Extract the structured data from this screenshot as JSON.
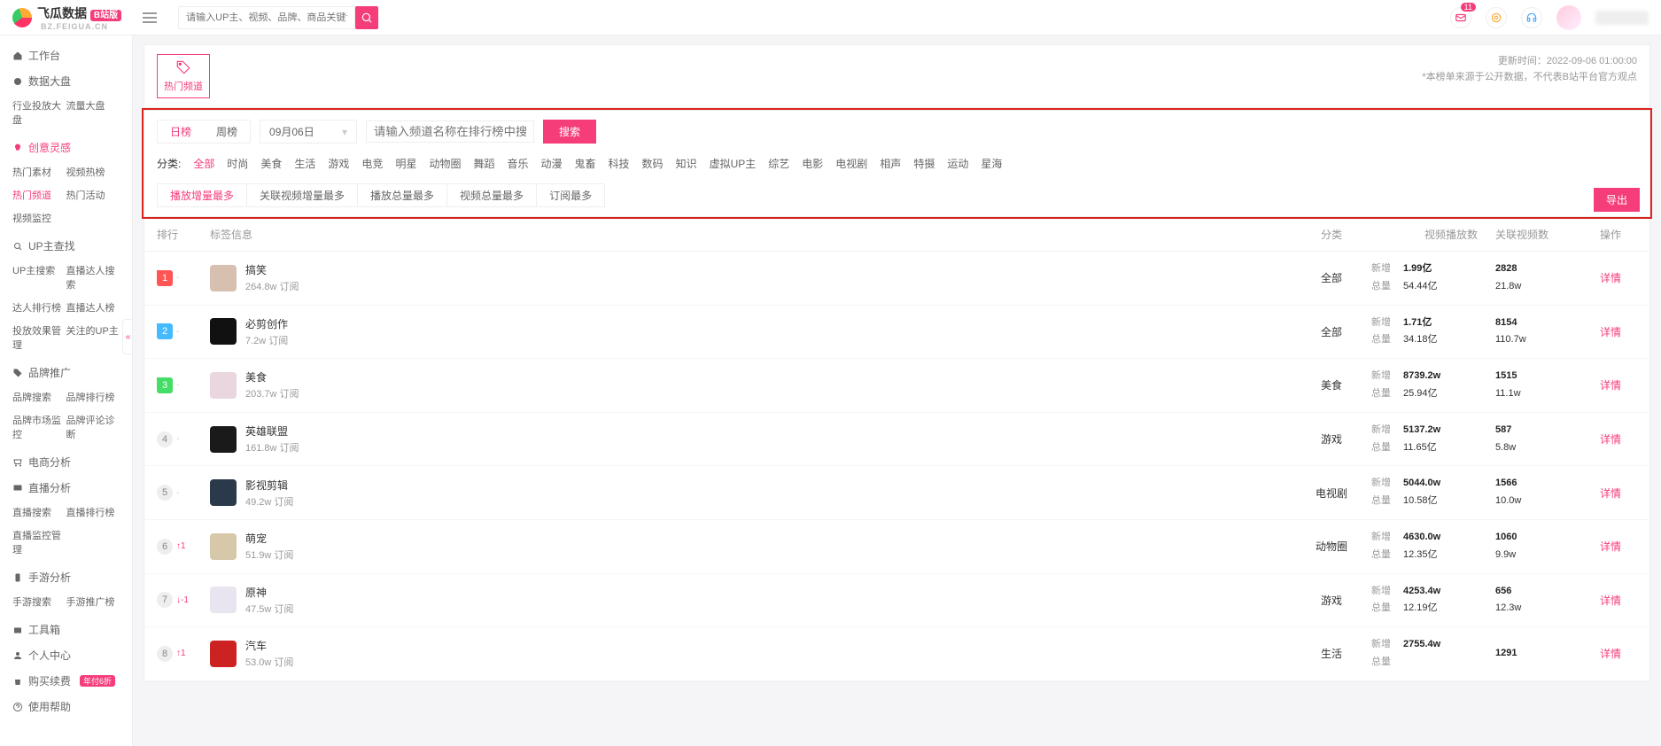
{
  "header": {
    "logo_text": "飞瓜数据",
    "logo_badge": "B站版",
    "logo_sub": "BZ.FEIGUA.CN",
    "search_placeholder": "请输入UP主、视频、品牌、商品关键词搜索",
    "notification_count": "11"
  },
  "sidebar": {
    "workbench": "工作台",
    "data_board": {
      "title": "数据大盘",
      "items": [
        "行业投放大盘",
        "流量大盘"
      ]
    },
    "creative": {
      "title": "创意灵感",
      "items": [
        "热门素材",
        "视频热榜",
        "热门频道",
        "热门活动",
        "视频监控"
      ]
    },
    "up_search": {
      "title": "UP主查找",
      "items": [
        "UP主搜索",
        "直播达人搜索",
        "达人排行榜",
        "直播达人榜",
        "投放效果管理",
        "关注的UP主"
      ]
    },
    "brand": {
      "title": "品牌推广",
      "items": [
        "品牌搜索",
        "品牌排行榜",
        "品牌市场监控",
        "品牌评论诊断"
      ]
    },
    "ecom": {
      "title": "电商分析"
    },
    "live": {
      "title": "直播分析",
      "items": [
        "直播搜索",
        "直播排行榜",
        "直播监控管理"
      ]
    },
    "mobile": {
      "title": "手游分析",
      "items": [
        "手游搜索",
        "手游推广榜"
      ]
    },
    "toolbox": "工具箱",
    "personal": "个人中心",
    "purchase": "购买续费",
    "purchase_badge": "年付6折",
    "help": "使用帮助"
  },
  "top": {
    "channel_label": "热门频道",
    "update_prefix": "更新时间：",
    "update_time": "2022-09-06 01:00:00",
    "disclaimer": "*本榜单来源于公开数据，不代表B站平台官方观点"
  },
  "filter": {
    "tab_day": "日榜",
    "tab_week": "周榜",
    "date_value": "09月06日",
    "channel_search_placeholder": "请输入频道名称在排行榜中搜索",
    "search_btn": "搜索",
    "category_label": "分类:",
    "categories": [
      "全部",
      "时尚",
      "美食",
      "生活",
      "游戏",
      "电竞",
      "明星",
      "动物圈",
      "舞蹈",
      "音乐",
      "动漫",
      "鬼畜",
      "科技",
      "数码",
      "知识",
      "虚拟UP主",
      "综艺",
      "电影",
      "电视剧",
      "相声",
      "特摄",
      "运动",
      "星海"
    ],
    "sort_tabs": [
      "播放增量最多",
      "关联视频增量最多",
      "播放总量最多",
      "视频总量最多",
      "订阅最多"
    ],
    "export_btn": "导出"
  },
  "table": {
    "columns": {
      "rank": "排行",
      "info": "标签信息",
      "cat": "分类",
      "play": "视频播放数",
      "rel": "关联视频数",
      "act": "操作"
    },
    "stat_new": "新增",
    "stat_total": "总量",
    "detail": "详情",
    "sub_unit": " 订阅",
    "rows": [
      {
        "rank": "1",
        "delta": "-",
        "name": "搞笑",
        "sub": "264.8w",
        "cat": "全部",
        "play_new": "1.99亿",
        "play_total": "54.44亿",
        "rel_new": "2828",
        "rel_total": "21.8w",
        "thumb": "#d8c0b0"
      },
      {
        "rank": "2",
        "delta": "-",
        "name": "必剪创作",
        "sub": "7.2w",
        "cat": "全部",
        "play_new": "1.71亿",
        "play_total": "34.18亿",
        "rel_new": "8154",
        "rel_total": "110.7w",
        "thumb": "#111"
      },
      {
        "rank": "3",
        "delta": "-",
        "name": "美食",
        "sub": "203.7w",
        "cat": "美食",
        "play_new": "8739.2w",
        "play_total": "25.94亿",
        "rel_new": "1515",
        "rel_total": "11.1w",
        "thumb": "#e9d6de"
      },
      {
        "rank": "4",
        "delta": "-",
        "name": "英雄联盟",
        "sub": "161.8w",
        "cat": "游戏",
        "play_new": "5137.2w",
        "play_total": "11.65亿",
        "rel_new": "587",
        "rel_total": "5.8w",
        "thumb": "#1a1a1a"
      },
      {
        "rank": "5",
        "delta": "-",
        "name": "影视剪辑",
        "sub": "49.2w",
        "cat": "电视剧",
        "play_new": "5044.0w",
        "play_total": "10.58亿",
        "rel_new": "1566",
        "rel_total": "10.0w",
        "thumb": "#2a3a4a"
      },
      {
        "rank": "6",
        "delta": "↑1",
        "name": "萌宠",
        "sub": "51.9w",
        "cat": "动物圈",
        "play_new": "4630.0w",
        "play_total": "12.35亿",
        "rel_new": "1060",
        "rel_total": "9.9w",
        "thumb": "#d6c8a8"
      },
      {
        "rank": "7",
        "delta": "↓-1",
        "name": "原神",
        "sub": "47.5w",
        "cat": "游戏",
        "play_new": "4253.4w",
        "play_total": "12.19亿",
        "rel_new": "656",
        "rel_total": "12.3w",
        "thumb": "#e8e4f0"
      },
      {
        "rank": "8",
        "delta": "↑1",
        "name": "汽车",
        "sub": "53.0w",
        "cat": "生活",
        "play_new": "2755.4w",
        "play_total": "",
        "rel_new": "1291",
        "rel_total": "",
        "thumb": "#c22"
      }
    ]
  }
}
